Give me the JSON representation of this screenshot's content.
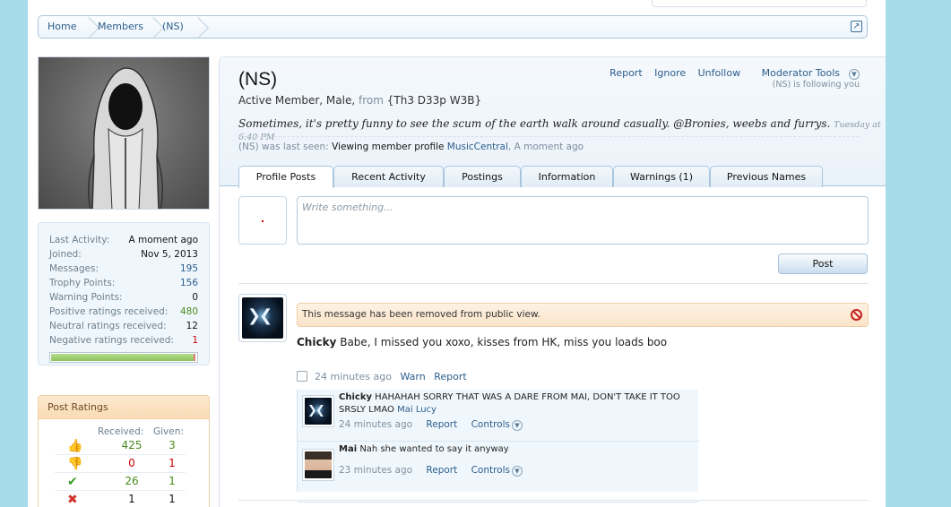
{
  "breadcrumb": {
    "items": [
      "Home",
      "Members",
      "(NS)"
    ]
  },
  "profile": {
    "username": "(NS)",
    "title_line": "Active Member, Male,",
    "from_label": "from",
    "location": "{Th3 D33p W3B}",
    "status": "Sometimes, it's pretty funny to see the scum of the earth walk around casually. @Bronies, weebs and furrys.",
    "status_time": "Tuesday at 6:40 PM",
    "last_seen_prefix": "(NS) was last seen:",
    "last_seen_activity": "Viewing member profile",
    "last_seen_target": "MusicCentral",
    "last_seen_time": ", A moment ago",
    "following_text": "(NS) is following you"
  },
  "actions": {
    "report": "Report",
    "ignore": "Ignore",
    "unfollow": "Unfollow",
    "moderator_tools": "Moderator Tools"
  },
  "stats": [
    {
      "label": "Last Activity:",
      "value": "A moment ago",
      "style": ""
    },
    {
      "label": "Joined:",
      "value": "Nov 5, 2013",
      "style": ""
    },
    {
      "label": "Messages:",
      "value": "195",
      "style": "link"
    },
    {
      "label": "Trophy Points:",
      "value": "156",
      "style": "link"
    },
    {
      "label": "Warning Points:",
      "value": "0",
      "style": ""
    },
    {
      "label": "Positive ratings received:",
      "value": "480",
      "style": "green"
    },
    {
      "label": "Neutral ratings received:",
      "value": "12",
      "style": ""
    },
    {
      "label": "Negative ratings received:",
      "value": "1",
      "style": "red"
    }
  ],
  "rating_bar_positive_fraction": 0.98,
  "post_ratings": {
    "title": "Post Ratings",
    "received_label": "Received:",
    "given_label": "Given:",
    "rows": [
      {
        "icon": "thumbs-up-icon",
        "received": "425",
        "given": "3"
      },
      {
        "icon": "thumbs-down-icon",
        "received": "0",
        "given": "1"
      },
      {
        "icon": "check-icon",
        "received": "26",
        "given": "1"
      },
      {
        "icon": "cross-icon",
        "received": "1",
        "given": "1"
      }
    ]
  },
  "tabs": [
    "Profile Posts",
    "Recent Activity",
    "Postings",
    "Information",
    "Warnings (1)",
    "Previous Names"
  ],
  "composer": {
    "placeholder": "Write something...",
    "post_label": "Post"
  },
  "message": {
    "removed_notice": "This message has been removed from public view.",
    "author": "Chicky",
    "text": "Babe, I missed you xoxo, kisses from HK, miss you loads boo",
    "time": "24 minutes ago",
    "warn": "Warn",
    "report": "Report"
  },
  "comments": [
    {
      "author": "Chicky",
      "text": "HAHAHAH SORRY THAT WAS A DARE FROM MAI, DON'T TAKE IT TOO SRSLY LMAO",
      "mentions": "Mai Lucy",
      "time": "24 minutes ago",
      "report": "Report",
      "controls": "Controls"
    },
    {
      "author": "Mai",
      "text": "Nah she wanted to say it anyway",
      "mentions": "",
      "time": "23 minutes ago",
      "report": "Report",
      "controls": "Controls"
    }
  ],
  "colors": {
    "background": "#a6dcea",
    "link": "#2b5d8c",
    "positive": "#4b8a1b",
    "negative": "#cc0000",
    "notice": "#fbe4c9"
  }
}
